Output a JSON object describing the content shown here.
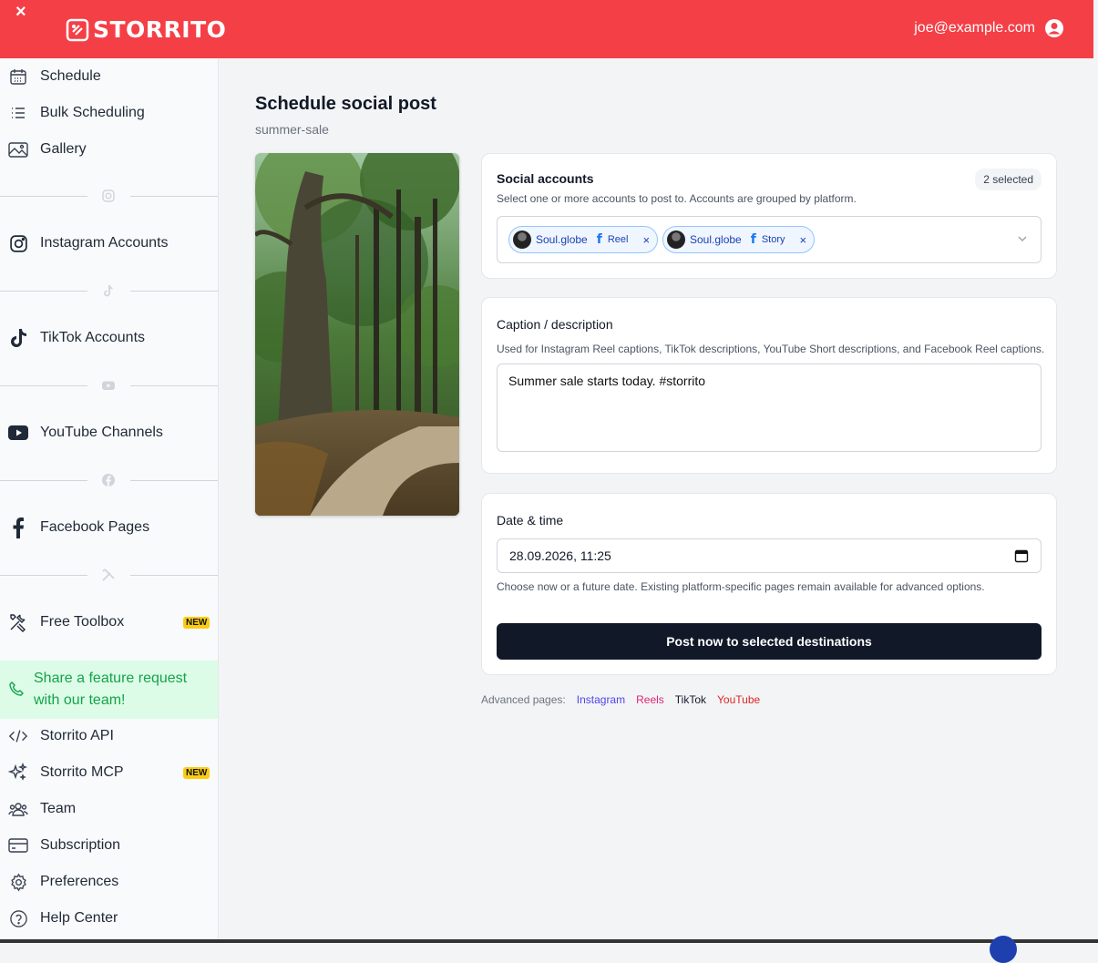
{
  "topbar": {
    "close": "×",
    "logo": "STORRITO",
    "user_email": "joe@example.com"
  },
  "sidebar": {
    "items": [
      {
        "label": "Schedule",
        "icon": "calendar-icon"
      },
      {
        "label": "Bulk Scheduling",
        "icon": "list-icon"
      },
      {
        "label": "Gallery",
        "icon": "image-icon"
      },
      {
        "label": "Instagram Accounts",
        "icon": "instagram-icon"
      },
      {
        "label": "TikTok Accounts",
        "icon": "tiktok-icon"
      },
      {
        "label": "YouTube Channels",
        "icon": "youtube-icon"
      },
      {
        "label": "Facebook Pages",
        "icon": "facebook-icon"
      },
      {
        "label": "Free Toolbox",
        "icon": "tools-icon",
        "badge": "NEW"
      },
      {
        "label": "Storrito API",
        "icon": "code-icon"
      },
      {
        "label": "Storrito MCP",
        "icon": "sparkles-icon",
        "badge": "NEW"
      },
      {
        "label": "Team",
        "icon": "team-icon"
      },
      {
        "label": "Subscription",
        "icon": "credit-card-icon"
      },
      {
        "label": "Preferences",
        "icon": "gear-icon"
      },
      {
        "label": "Help Center",
        "icon": "help-icon"
      }
    ],
    "feature_request": "Share a feature request with our team!"
  },
  "page": {
    "title": "Schedule social post",
    "subtitle": "summer-sale"
  },
  "accounts": {
    "title": "Social accounts",
    "hint": "Select one or more accounts to post to. Accounts are grouped by platform.",
    "selected_badge": "2 selected",
    "chips": [
      {
        "name": "Soul.globe",
        "type": "Reel",
        "remove": "×"
      },
      {
        "name": "Soul.globe",
        "type": "Story",
        "remove": "×"
      }
    ]
  },
  "caption": {
    "title": "Caption / description",
    "hint": "Used for Instagram Reel captions, TikTok descriptions, YouTube Short descriptions, and Facebook Reel captions.",
    "value": "Summer sale starts today. #storrito"
  },
  "datetime": {
    "title": "Date & time",
    "value": "28.09.2026, 11:25",
    "hint": "Choose now or a future date. Existing platform-specific pages remain available for advanced options."
  },
  "post_button": "Post now to selected destinations",
  "advanced": {
    "label": "Advanced pages:",
    "links": [
      {
        "label": "Instagram",
        "color": "#4f46e5"
      },
      {
        "label": "Reels",
        "color": "#db2777"
      },
      {
        "label": "TikTok",
        "color": "#111827"
      },
      {
        "label": "YouTube",
        "color": "#dc2626"
      }
    ]
  },
  "colors": {
    "brand": "#f43f46",
    "feature_bg": "#dcfce7",
    "button": "#111827"
  }
}
